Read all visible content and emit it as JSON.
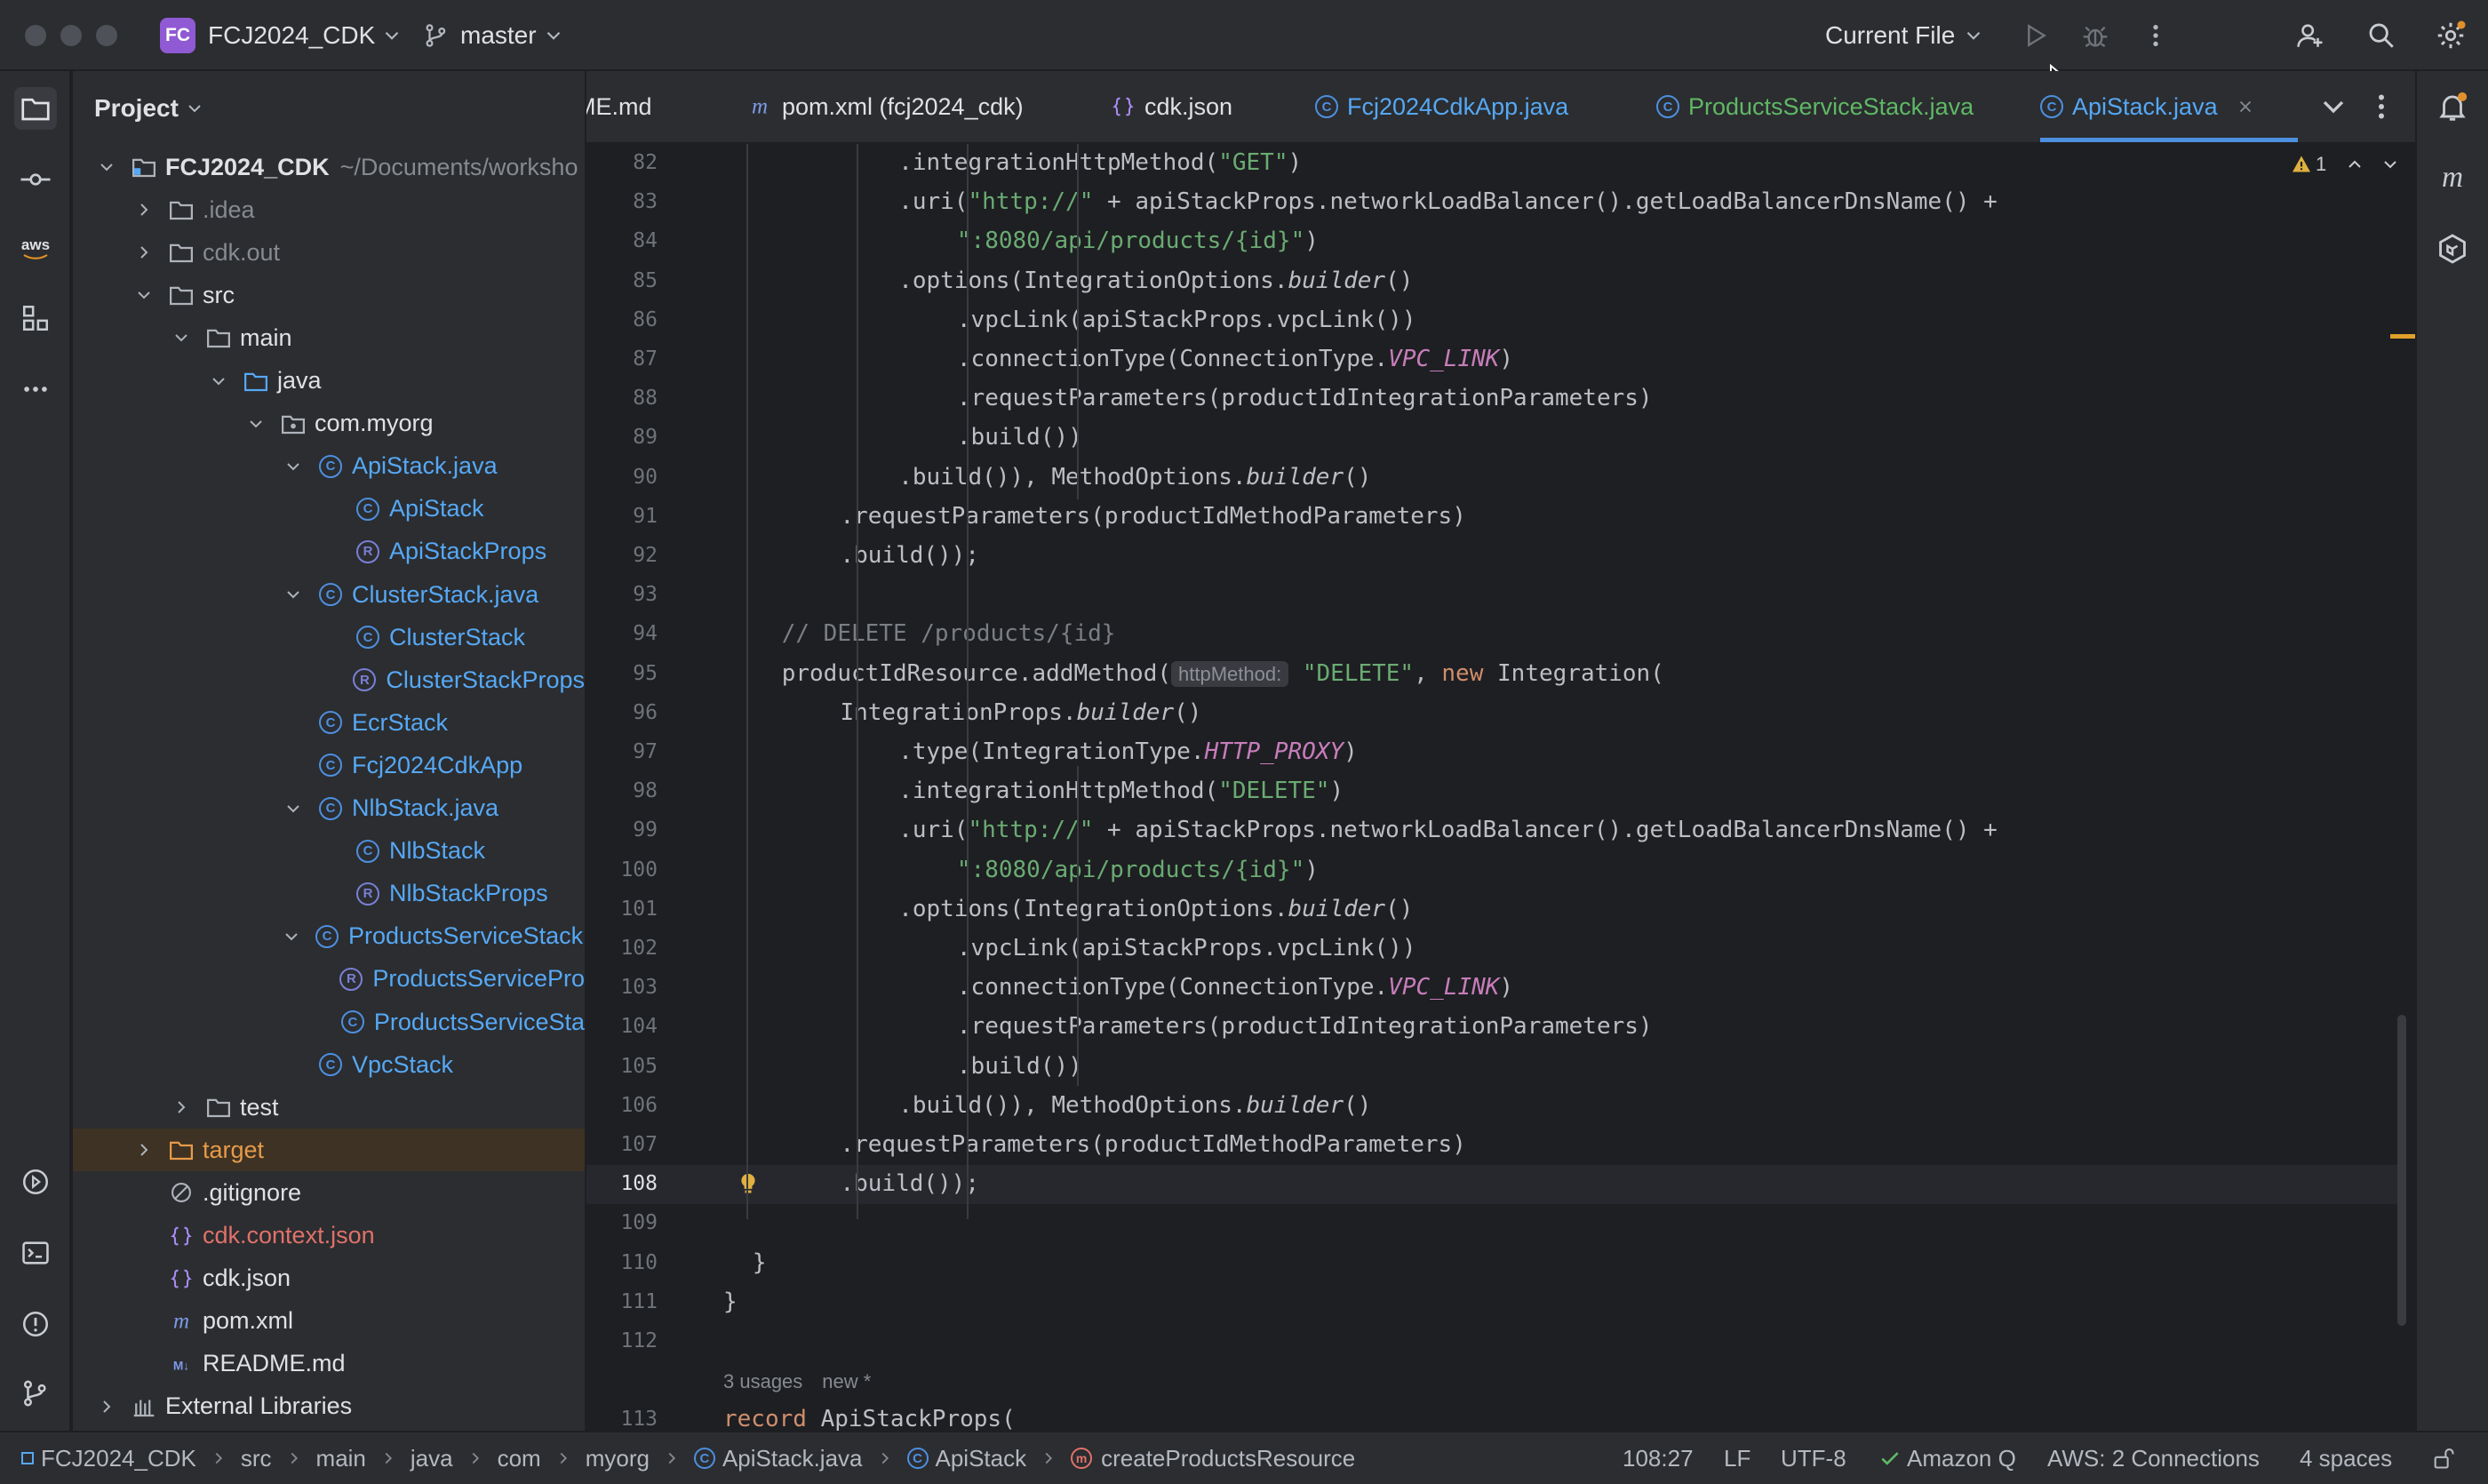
{
  "titlebar": {
    "project_badge": "FC",
    "project_name": "FCJ2024_CDK",
    "branch": "master",
    "run_config": "Current File"
  },
  "project_panel": {
    "title": "Project",
    "tree": [
      {
        "label": "FCJ2024_CDK",
        "hint": "~/Documents/worksho",
        "indent": 0,
        "arrow": "down",
        "icon": "module",
        "color": "default",
        "bold": true
      },
      {
        "label": ".idea",
        "indent": 1,
        "arrow": "right",
        "icon": "folder",
        "color": "muted"
      },
      {
        "label": "cdk.out",
        "indent": 1,
        "arrow": "right",
        "icon": "folder",
        "color": "muted"
      },
      {
        "label": "src",
        "indent": 1,
        "arrow": "down",
        "icon": "folder",
        "color": "default"
      },
      {
        "label": "main",
        "indent": 2,
        "arrow": "down",
        "icon": "folder",
        "color": "default"
      },
      {
        "label": "java",
        "indent": 3,
        "arrow": "down",
        "icon": "folder-blue",
        "color": "default"
      },
      {
        "label": "com.myorg",
        "indent": 4,
        "arrow": "down",
        "icon": "package",
        "color": "default"
      },
      {
        "label": "ApiStack.java",
        "indent": 5,
        "arrow": "down",
        "icon": "class",
        "color": "blue"
      },
      {
        "label": "ApiStack",
        "indent": 6,
        "arrow": "none",
        "icon": "class",
        "color": "blue"
      },
      {
        "label": "ApiStackProps",
        "indent": 6,
        "arrow": "none",
        "icon": "record",
        "color": "blue"
      },
      {
        "label": "ClusterStack.java",
        "indent": 5,
        "arrow": "down",
        "icon": "class",
        "color": "blue"
      },
      {
        "label": "ClusterStack",
        "indent": 6,
        "arrow": "none",
        "icon": "class",
        "color": "blue"
      },
      {
        "label": "ClusterStackProps",
        "indent": 6,
        "arrow": "none",
        "icon": "record",
        "color": "blue"
      },
      {
        "label": "EcrStack",
        "indent": 5,
        "arrow": "none",
        "icon": "class",
        "color": "blue"
      },
      {
        "label": "Fcj2024CdkApp",
        "indent": 5,
        "arrow": "none",
        "icon": "class",
        "color": "blue"
      },
      {
        "label": "NlbStack.java",
        "indent": 5,
        "arrow": "down",
        "icon": "class",
        "color": "blue"
      },
      {
        "label": "NlbStack",
        "indent": 6,
        "arrow": "none",
        "icon": "class",
        "color": "blue"
      },
      {
        "label": "NlbStackProps",
        "indent": 6,
        "arrow": "none",
        "icon": "record",
        "color": "blue"
      },
      {
        "label": "ProductsServiceStack.j",
        "indent": 5,
        "arrow": "down",
        "icon": "class",
        "color": "blue"
      },
      {
        "label": "ProductsServicePro",
        "indent": 6,
        "arrow": "none",
        "icon": "record",
        "color": "blue"
      },
      {
        "label": "ProductsServiceSta",
        "indent": 6,
        "arrow": "none",
        "icon": "class",
        "color": "blue"
      },
      {
        "label": "VpcStack",
        "indent": 5,
        "arrow": "none",
        "icon": "class",
        "color": "blue"
      },
      {
        "label": "test",
        "indent": 2,
        "arrow": "right",
        "icon": "folder",
        "color": "default"
      },
      {
        "label": "target",
        "indent": 1,
        "arrow": "right",
        "icon": "folder-orange",
        "color": "orange",
        "highlight": true
      },
      {
        "label": ".gitignore",
        "indent": 1,
        "arrow": "none",
        "icon": "ignore",
        "color": "default"
      },
      {
        "label": "cdk.context.json",
        "indent": 1,
        "arrow": "none",
        "icon": "json",
        "color": "red"
      },
      {
        "label": "cdk.json",
        "indent": 1,
        "arrow": "none",
        "icon": "json",
        "color": "default"
      },
      {
        "label": "pom.xml",
        "indent": 1,
        "arrow": "none",
        "icon": "maven",
        "color": "default"
      },
      {
        "label": "README.md",
        "indent": 1,
        "arrow": "none",
        "icon": "markdown",
        "color": "default"
      },
      {
        "label": "External Libraries",
        "indent": 0,
        "arrow": "right",
        "icon": "library",
        "color": "default"
      }
    ]
  },
  "tabs": [
    {
      "label": "ME.md",
      "icon": "none",
      "color": "default"
    },
    {
      "label": "pom.xml (fcj2024_cdk)",
      "icon": "maven",
      "color": "default"
    },
    {
      "label": "cdk.json",
      "icon": "json",
      "color": "default"
    },
    {
      "label": "Fcj2024CdkApp.java",
      "icon": "class",
      "color": "blue"
    },
    {
      "label": "ProductsServiceStack.java",
      "icon": "class",
      "color": "green"
    },
    {
      "label": "ApiStack.java",
      "icon": "class",
      "color": "blue",
      "active": true
    }
  ],
  "editor": {
    "warning_count": "1",
    "current_line": "108",
    "usages_hint": "3 usages",
    "new_hint": "new *",
    "lines": [
      {
        "n": "82",
        "indent": 12,
        "parts": [
          {
            "t": ".integrationHttpMethod("
          },
          {
            "t": "\"GET\"",
            "c": "str"
          },
          {
            "t": ")"
          }
        ]
      },
      {
        "n": "83",
        "indent": 12,
        "parts": [
          {
            "t": ".uri("
          },
          {
            "t": "\"http://\"",
            "c": "str"
          },
          {
            "t": " + apiStackProps.networkLoadBalancer().getLoadBalancerDnsName() +"
          }
        ]
      },
      {
        "n": "84",
        "indent": 16,
        "parts": [
          {
            "t": "\":8080/api/products/{id}\"",
            "c": "str"
          },
          {
            "t": ")"
          }
        ]
      },
      {
        "n": "85",
        "indent": 12,
        "parts": [
          {
            "t": ".options(IntegrationOptions."
          },
          {
            "t": "builder",
            "c": "it"
          },
          {
            "t": "()"
          }
        ]
      },
      {
        "n": "86",
        "indent": 16,
        "parts": [
          {
            "t": ".vpcLink(apiStackProps.vpcLink())"
          }
        ]
      },
      {
        "n": "87",
        "indent": 16,
        "parts": [
          {
            "t": ".connectionType(ConnectionType."
          },
          {
            "t": "VPC_LINK",
            "c": "const"
          },
          {
            "t": ")"
          }
        ]
      },
      {
        "n": "88",
        "indent": 16,
        "parts": [
          {
            "t": ".requestParameters(productIdIntegrationParameters)"
          }
        ]
      },
      {
        "n": "89",
        "indent": 16,
        "parts": [
          {
            "t": ".build())"
          }
        ]
      },
      {
        "n": "90",
        "indent": 12,
        "parts": [
          {
            "t": ".build()), MethodOptions."
          },
          {
            "t": "builder",
            "c": "it"
          },
          {
            "t": "()"
          }
        ]
      },
      {
        "n": "91",
        "indent": 8,
        "parts": [
          {
            "t": ".requestParameters(productIdMethodParameters)"
          }
        ]
      },
      {
        "n": "92",
        "indent": 8,
        "parts": [
          {
            "t": ".build());"
          }
        ]
      },
      {
        "n": "93",
        "indent": 0,
        "parts": []
      },
      {
        "n": "94",
        "indent": 4,
        "parts": [
          {
            "t": "// DELETE /products/{id}",
            "c": "comment"
          }
        ]
      },
      {
        "n": "95",
        "indent": 4,
        "parts": [
          {
            "t": "productIdResource.addMethod("
          },
          {
            "t": "httpMethod:",
            "c": "hint"
          },
          {
            "t": " "
          },
          {
            "t": "\"DELETE\"",
            "c": "str"
          },
          {
            "t": ", "
          },
          {
            "t": "new",
            "c": "kw"
          },
          {
            "t": " Integration("
          }
        ]
      },
      {
        "n": "96",
        "indent": 8,
        "parts": [
          {
            "t": "IntegrationProps."
          },
          {
            "t": "builder",
            "c": "it"
          },
          {
            "t": "()"
          }
        ]
      },
      {
        "n": "97",
        "indent": 12,
        "parts": [
          {
            "t": ".type(IntegrationType."
          },
          {
            "t": "HTTP_PROXY",
            "c": "const"
          },
          {
            "t": ")"
          }
        ]
      },
      {
        "n": "98",
        "indent": 12,
        "parts": [
          {
            "t": ".integrationHttpMethod("
          },
          {
            "t": "\"DELETE\"",
            "c": "str"
          },
          {
            "t": ")"
          }
        ]
      },
      {
        "n": "99",
        "indent": 12,
        "parts": [
          {
            "t": ".uri("
          },
          {
            "t": "\"http://\"",
            "c": "str"
          },
          {
            "t": " + apiStackProps.networkLoadBalancer().getLoadBalancerDnsName() +"
          }
        ]
      },
      {
        "n": "100",
        "indent": 16,
        "parts": [
          {
            "t": "\":8080/api/products/{id}\"",
            "c": "str"
          },
          {
            "t": ")"
          }
        ]
      },
      {
        "n": "101",
        "indent": 12,
        "parts": [
          {
            "t": ".options(IntegrationOptions."
          },
          {
            "t": "builder",
            "c": "it"
          },
          {
            "t": "()"
          }
        ]
      },
      {
        "n": "102",
        "indent": 16,
        "parts": [
          {
            "t": ".vpcLink(apiStackProps.vpcLink())"
          }
        ]
      },
      {
        "n": "103",
        "indent": 16,
        "parts": [
          {
            "t": ".connectionType(ConnectionType."
          },
          {
            "t": "VPC_LINK",
            "c": "const"
          },
          {
            "t": ")"
          }
        ]
      },
      {
        "n": "104",
        "indent": 16,
        "parts": [
          {
            "t": ".requestParameters(productIdIntegrationParameters)"
          }
        ]
      },
      {
        "n": "105",
        "indent": 16,
        "parts": [
          {
            "t": ".build())"
          }
        ]
      },
      {
        "n": "106",
        "indent": 12,
        "parts": [
          {
            "t": ".build()), MethodOptions."
          },
          {
            "t": "builder",
            "c": "it"
          },
          {
            "t": "()"
          }
        ]
      },
      {
        "n": "107",
        "indent": 8,
        "parts": [
          {
            "t": ".requestParameters(productIdMethodParameters)"
          }
        ]
      },
      {
        "n": "108",
        "indent": 8,
        "parts": [
          {
            "t": ".build());"
          }
        ]
      },
      {
        "n": "109",
        "indent": 0,
        "parts": []
      },
      {
        "n": "110",
        "indent": 2,
        "parts": [
          {
            "t": "}"
          }
        ]
      },
      {
        "n": "111",
        "indent": 0,
        "parts": [
          {
            "t": "}"
          }
        ]
      },
      {
        "n": "112",
        "indent": 0,
        "parts": []
      },
      {
        "n": "113",
        "indent": 0,
        "parts": [
          {
            "t": "record",
            "c": "kw"
          },
          {
            "t": " ApiStackProps("
          }
        ]
      }
    ]
  },
  "statusbar": {
    "breadcrumbs": [
      {
        "label": "FCJ2024_CDK",
        "icon": "module"
      },
      {
        "label": "src",
        "icon": "none"
      },
      {
        "label": "main",
        "icon": "none"
      },
      {
        "label": "java",
        "icon": "none"
      },
      {
        "label": "com",
        "icon": "none"
      },
      {
        "label": "myorg",
        "icon": "none"
      },
      {
        "label": "ApiStack.java",
        "icon": "class"
      },
      {
        "label": "ApiStack",
        "icon": "class"
      },
      {
        "label": "createProductsResource",
        "icon": "method"
      }
    ],
    "position": "108:27",
    "line_sep": "LF",
    "encoding": "UTF-8",
    "amazon_q": "Amazon Q",
    "aws": "AWS: 2 Connections",
    "indent": "4 spaces"
  },
  "colors": {
    "accent": "#4d8fe0",
    "class_icon": "#4d8fe0",
    "string": "#6aab73",
    "keyword": "#cf8e6d",
    "constant": "#c77dbb",
    "warning": "#e0b040",
    "badge": "#8f5ad3"
  }
}
